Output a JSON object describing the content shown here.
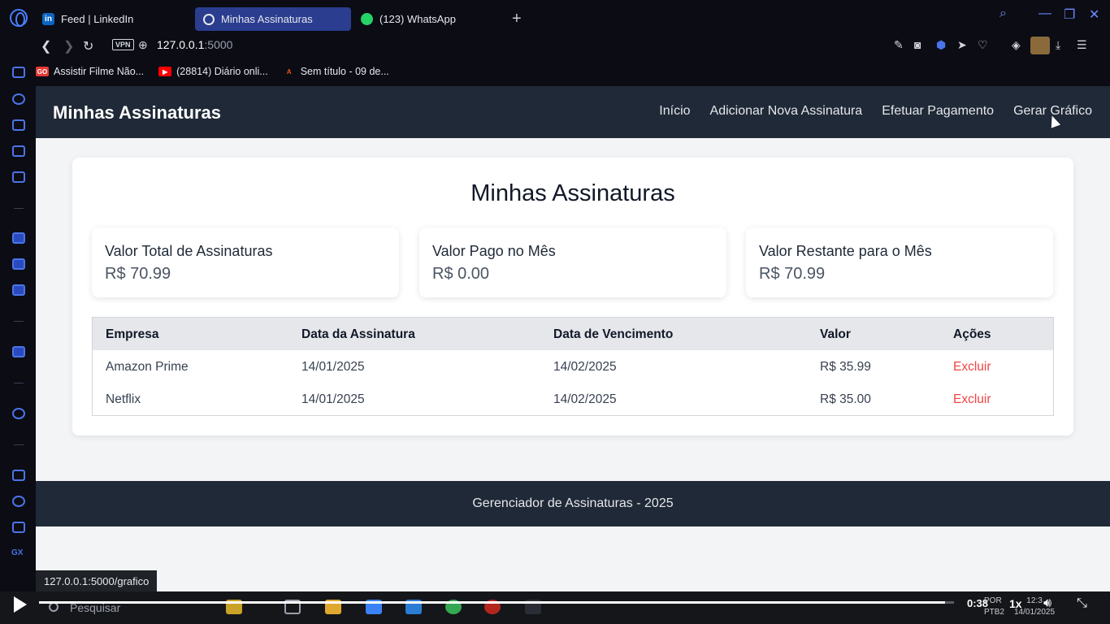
{
  "browser": {
    "tabs": [
      {
        "label": "Feed | LinkedIn",
        "icon": "linkedin-icon"
      },
      {
        "label": "Minhas Assinaturas",
        "icon": "globe-icon",
        "active": true
      },
      {
        "label": "(123) WhatsApp",
        "icon": "whatsapp-icon"
      }
    ],
    "vpn_label": "VPN",
    "url_host": "127.0.0.1",
    "url_port": ":5000",
    "bookmarks": [
      {
        "label": "Assistir Filme Não...",
        "icon_text": "GO",
        "color": "#e53935"
      },
      {
        "label": "(28814) Diário onli...",
        "icon_text": "▶",
        "color": "#ff0000"
      },
      {
        "label": "Sem título - 09 de...",
        "icon_text": "A",
        "color": "#f4511e"
      }
    ],
    "sidebar_text": "GX",
    "status_link": "127.0.0.1:5000/grafico"
  },
  "page": {
    "brand": "Minhas Assinaturas",
    "nav": [
      "Início",
      "Adicionar Nova Assinatura",
      "Efetuar Pagamento",
      "Gerar Gráfico"
    ],
    "heading": "Minhas Assinaturas",
    "stats": [
      {
        "label": "Valor Total de Assinaturas",
        "value": "R$ 70.99"
      },
      {
        "label": "Valor Pago no Mês",
        "value": "R$ 0.00"
      },
      {
        "label": "Valor Restante para o Mês",
        "value": "R$ 70.99"
      }
    ],
    "table": {
      "headers": [
        "Empresa",
        "Data da Assinatura",
        "Data de Vencimento",
        "Valor",
        "Ações"
      ],
      "rows": [
        [
          "Amazon Prime",
          "14/01/2025",
          "14/02/2025",
          "R$ 35.99",
          "Excluir"
        ],
        [
          "Netflix",
          "14/01/2025",
          "14/02/2025",
          "R$ 35.00",
          "Excluir"
        ]
      ]
    },
    "footer": "Gerenciador de Assinaturas - 2025"
  },
  "taskbar": {
    "search_placeholder": "Pesquisar",
    "lang_top": "POR",
    "lang_bottom": "PTB2",
    "time": "12:3",
    "date": "14/01/2025"
  },
  "player": {
    "current_time": "0:38",
    "speed": "1x",
    "progress": 0.99
  },
  "colors": {
    "navbar": "#1f2937",
    "delete_link": "#ef4444",
    "active_tab": "#2a3d8f"
  }
}
